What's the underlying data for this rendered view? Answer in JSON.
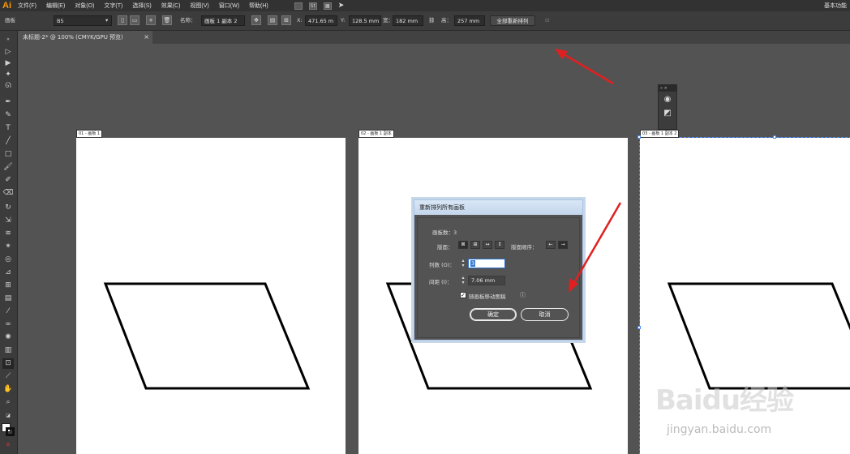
{
  "app": {
    "logo": "Ai",
    "workspace": "基本功能"
  },
  "menu": {
    "items": [
      "文件(F)",
      "编辑(E)",
      "对象(O)",
      "文字(T)",
      "选择(S)",
      "效果(C)",
      "视图(V)",
      "窗口(W)",
      "帮助(H)"
    ]
  },
  "control_bar": {
    "panel_label": "画板",
    "preset_value": "B5",
    "name_label": "名称：",
    "name_value": "画板 1 副本 2",
    "x_label": "X:",
    "x_value": "471.65 m",
    "y_label": "Y:",
    "y_value": "128.5 mm",
    "w_label": "宽：",
    "w_value": "182 mm",
    "h_label": "高：",
    "h_value": "257 mm",
    "rearrange_all_label": "全部重新排列"
  },
  "document_tab": {
    "title": "未标题-2* @ 100% (CMYK/GPU 预览)",
    "close": "×"
  },
  "artboards": [
    {
      "label": "01 - 画板 1"
    },
    {
      "label": "02 - 画板 1 副本"
    },
    {
      "label": "03 - 画板 1 副本 2"
    }
  ],
  "dialog": {
    "title": "重新排列所有画板",
    "artboard_count_label": "画板数：3",
    "layout_label": "版面：",
    "layout_order_label": "版面顺序：",
    "columns_label": "列数 (O)：",
    "columns_value": "3",
    "spacing_label": "间距 (I)：",
    "spacing_value": "7.06 mm",
    "move_artwork_label": "随画板移动图稿",
    "move_artwork_checked": true,
    "ok_label": "确定",
    "cancel_label": "取消"
  },
  "watermark": {
    "main": "Baidu经验",
    "sub": "jingyan.baidu.com"
  },
  "colors": {
    "menu_bg": "#323232",
    "panel_bg": "#3c3c3c",
    "canvas_bg": "#535353",
    "accent_arrow": "#e02020",
    "logo": "#ff9a00",
    "selection": "#4a8cff"
  }
}
